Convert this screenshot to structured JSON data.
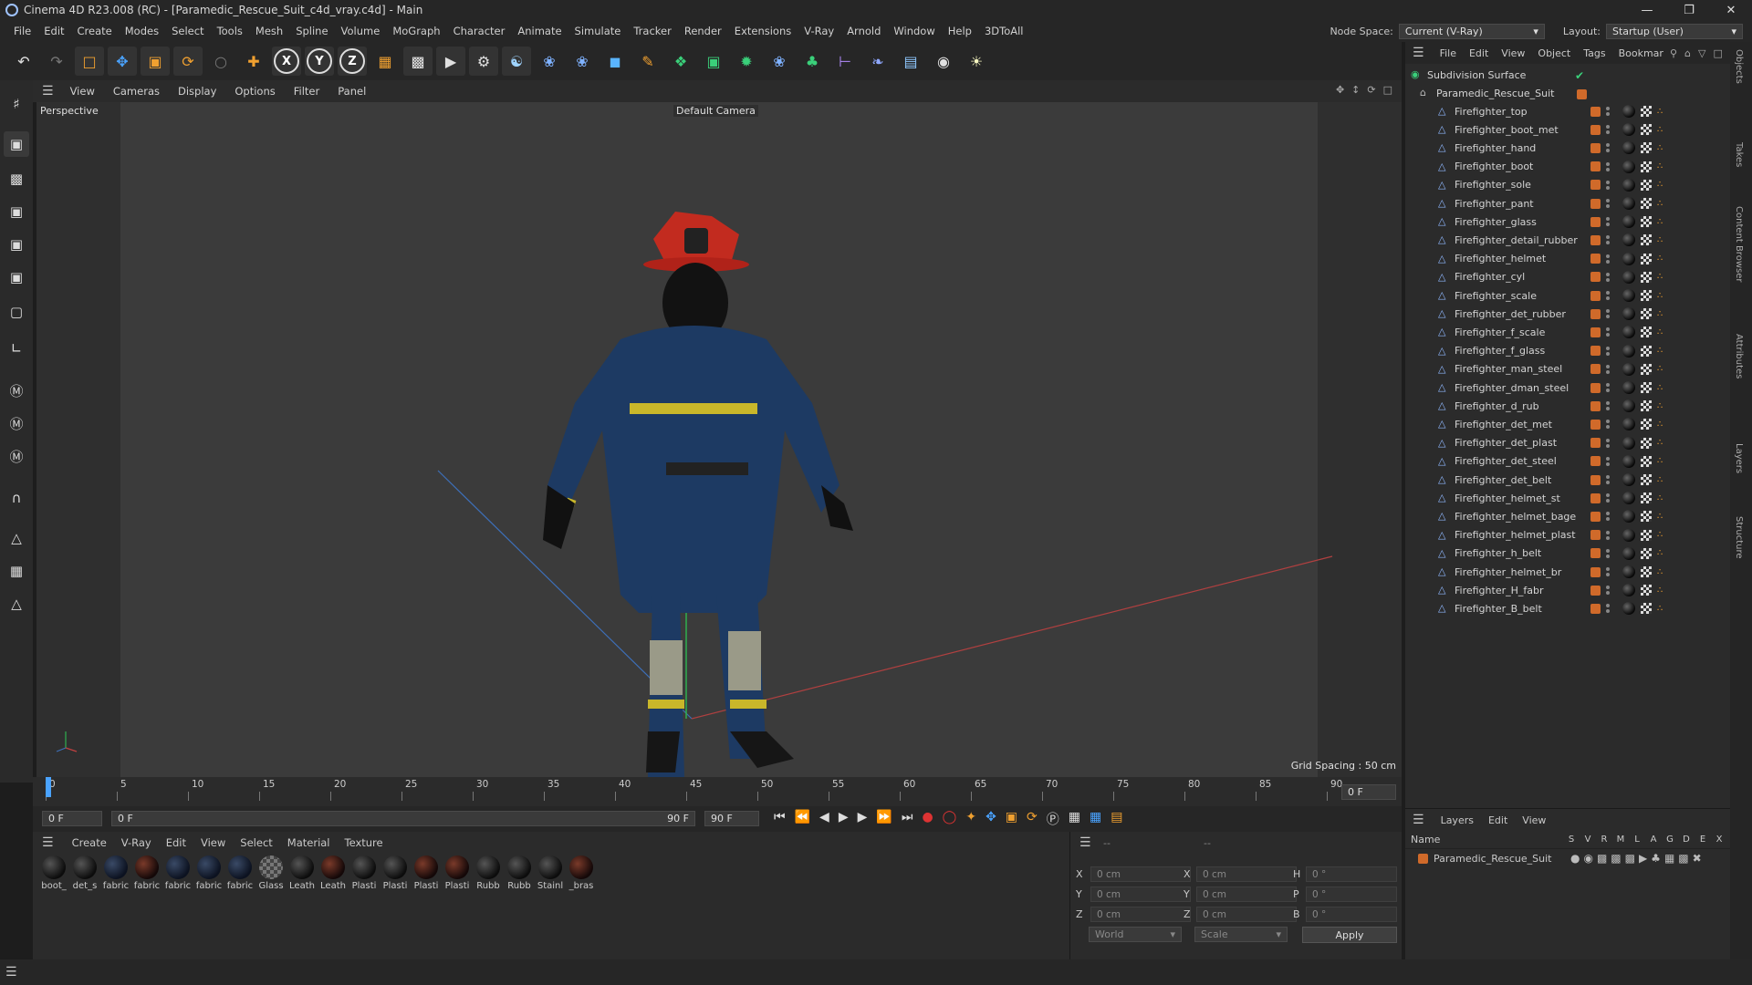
{
  "window": {
    "title": "Cinema 4D R23.008 (RC) - [Paramedic_Rescue_Suit_c4d_vray.c4d] - Main"
  },
  "menubar": {
    "items": [
      "File",
      "Edit",
      "Create",
      "Modes",
      "Select",
      "Tools",
      "Mesh",
      "Spline",
      "Volume",
      "MoGraph",
      "Character",
      "Animate",
      "Simulate",
      "Tracker",
      "Render",
      "Extensions",
      "V-Ray",
      "Arnold",
      "Window",
      "Help",
      "3DToAll"
    ],
    "node_space_label": "Node Space:",
    "node_space_value": "Current (V-Ray)",
    "layout_label": "Layout:",
    "layout_value": "Startup (User)"
  },
  "viewport": {
    "menu": [
      "View",
      "Cameras",
      "Display",
      "Options",
      "Filter",
      "Panel"
    ],
    "name": "Perspective",
    "camera": "Default Camera",
    "grid": "Grid Spacing : 50 cm"
  },
  "timeline": {
    "ticks": [
      "0",
      "5",
      "10",
      "15",
      "20",
      "25",
      "30",
      "35",
      "40",
      "45",
      "50",
      "55",
      "60",
      "65",
      "70",
      "75",
      "80",
      "85",
      "90"
    ],
    "current_right": "0 F"
  },
  "timectrl": {
    "start": "0 F",
    "current": "0 F",
    "end": "90 F",
    "end2": "90 F"
  },
  "materials": {
    "menu": [
      "Create",
      "V-Ray",
      "Edit",
      "View",
      "Select",
      "Material",
      "Texture"
    ],
    "items": [
      "boot_",
      "det_s",
      "fabric",
      "fabric",
      "fabric",
      "fabric",
      "fabric",
      "Glass",
      "Leath",
      "Leath",
      "Plasti",
      "Plasti",
      "Plasti",
      "Plasti",
      "Rubb",
      "Rubb",
      "Stainl",
      "_bras"
    ]
  },
  "coords": {
    "x1": "0 cm",
    "y1": "0 cm",
    "z1": "0 cm",
    "x2": "0 cm",
    "y2": "0 cm",
    "z2": "0 cm",
    "h": "0 °",
    "p": "0 °",
    "b": "0 °",
    "dash1": "--",
    "dash2": "--",
    "world": "World",
    "scale": "Scale",
    "apply": "Apply",
    "xl": "X",
    "yl": "Y",
    "zl": "Z",
    "hl": "H",
    "pl": "P",
    "bl": "B"
  },
  "objects": {
    "menu": [
      "File",
      "Edit",
      "View",
      "Object",
      "Tags",
      "Bookmar"
    ],
    "subdivision": "Subdivision Surface",
    "root": "Paramedic_Rescue_Suit",
    "items": [
      "Firefighter_top",
      "Firefighter_boot_met",
      "Firefighter_hand",
      "Firefighter_boot",
      "Firefighter_sole",
      "Firefighter_pant",
      "Firefighter_glass",
      "Firefighter_detail_rubber",
      "Firefighter_helmet",
      "Firefighter_cyl",
      "Firefighter_scale",
      "Firefighter_det_rubber",
      "Firefighter_f_scale",
      "Firefighter_f_glass",
      "Firefighter_man_steel",
      "Firefighter_dman_steel",
      "Firefighter_d_rub",
      "Firefighter_det_met",
      "Firefighter_det_plast",
      "Firefighter_det_steel",
      "Firefighter_det_belt",
      "Firefighter_helmet_st",
      "Firefighter_helmet_bage",
      "Firefighter_helmet_plast",
      "Firefighter_h_belt",
      "Firefighter_helmet_br",
      "Firefighter_H_fabr",
      "Firefighter_B_belt"
    ]
  },
  "layers": {
    "menu": [
      "Layers",
      "Edit",
      "View"
    ],
    "name_header": "Name",
    "cols": [
      "S",
      "V",
      "R",
      "M",
      "L",
      "A",
      "G",
      "D",
      "E",
      "X"
    ],
    "row": "Paramedic_Rescue_Suit"
  },
  "rightstrip": [
    "Objects",
    "Takes",
    "Content Browser",
    "Attributes",
    "Layers",
    "Structure"
  ],
  "colors": {
    "accent": "#d06a2a",
    "panel": "#2b2b2b",
    "viewport": "#3b3b3b"
  }
}
